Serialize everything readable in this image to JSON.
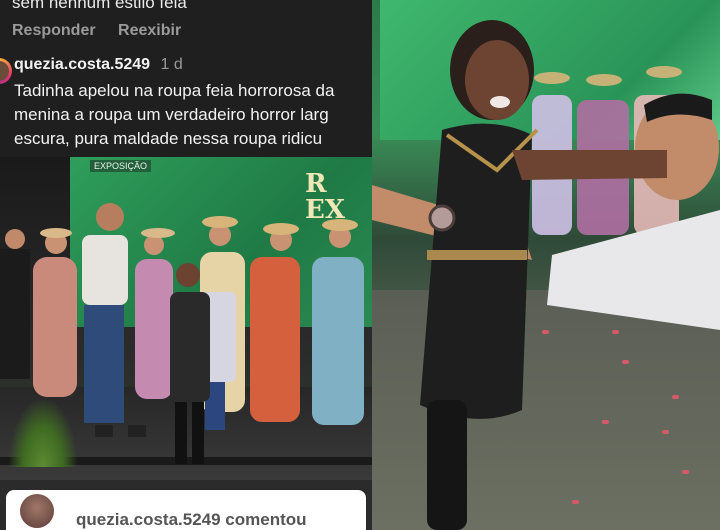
{
  "previous_comment": {
    "text": "sem nenhum estilo feia"
  },
  "comment_actions": {
    "reply": "Responder",
    "show": "Reexibir"
  },
  "comment": {
    "username": "quezia.costa.5249",
    "time": "1 d",
    "lines": [
      "Tadinha apelou na roupa feia horrorosa da",
      "menina a roupa um verdadeiro horror larg",
      "escura, pura maldade  nessa roupa ridicu"
    ]
  },
  "left_photo": {
    "screen_text_line1": "R",
    "screen_text_line2": "EX",
    "screen_label": "EXPOSIÇÃO"
  },
  "reply_notification": {
    "text": "quezia.costa.5249 comentou"
  },
  "colors": {
    "comment_bg": "#1f1f1f",
    "stage_green": "#2f9e5b"
  }
}
